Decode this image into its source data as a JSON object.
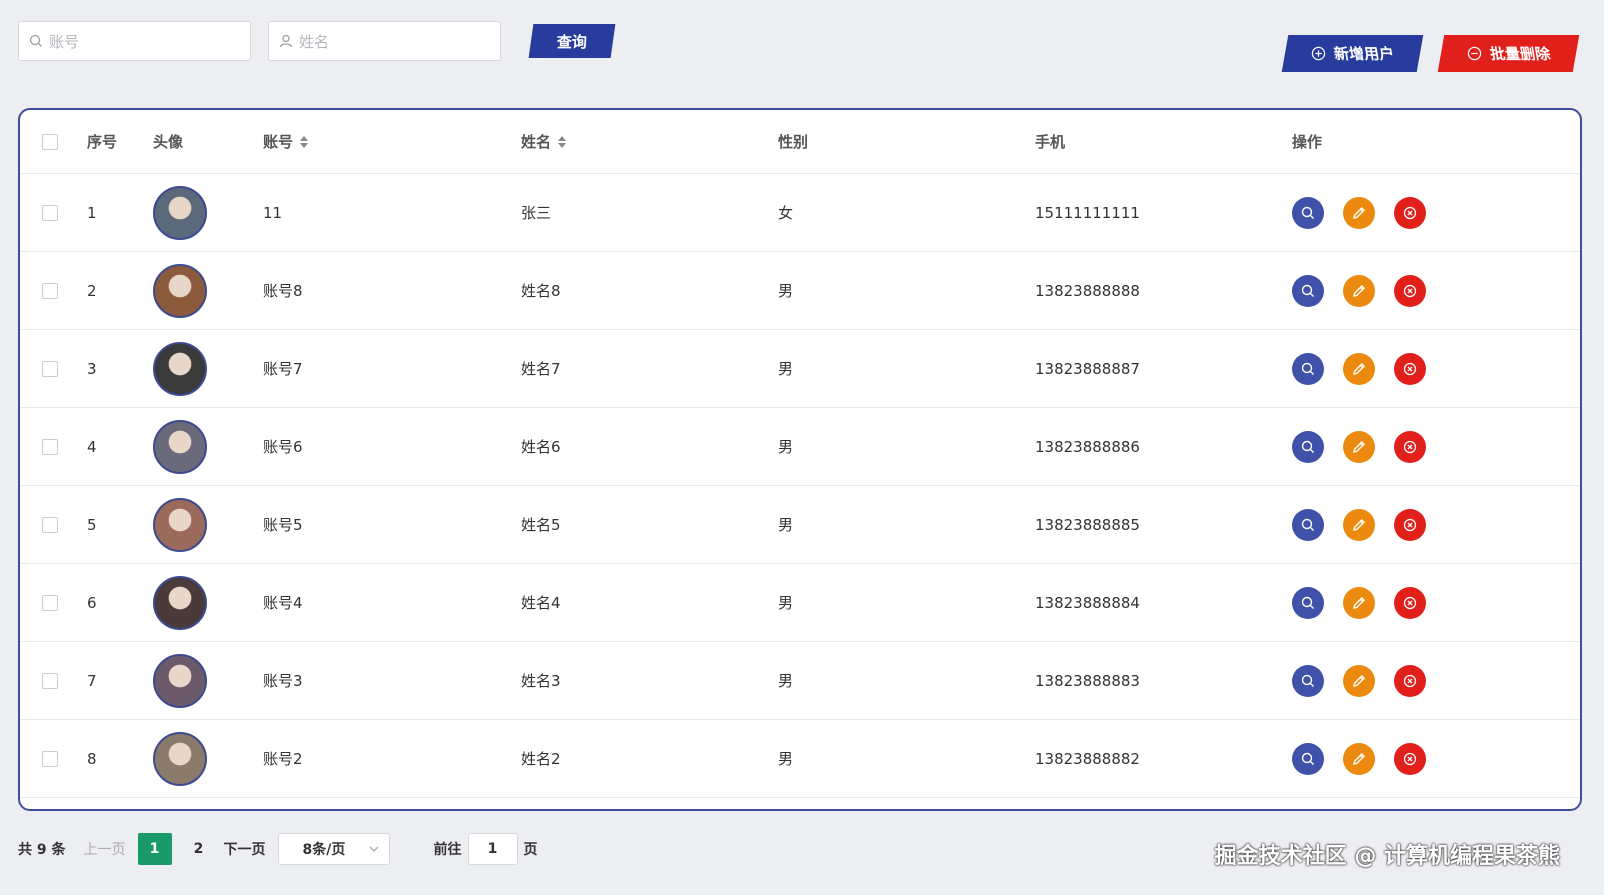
{
  "search": {
    "account_placeholder": "账号",
    "name_placeholder": "姓名",
    "query_label": "查询"
  },
  "toolbar": {
    "add_label": "新增用户",
    "batch_delete_label": "批量删除"
  },
  "table": {
    "headers": {
      "index": "序号",
      "avatar": "头像",
      "account": "账号",
      "name": "姓名",
      "gender": "性别",
      "phone": "手机",
      "actions": "操作"
    },
    "rows": [
      {
        "index": "1",
        "account": "11",
        "name": "张三",
        "gender": "女",
        "phone": "15111111111"
      },
      {
        "index": "2",
        "account": "账号8",
        "name": "姓名8",
        "gender": "男",
        "phone": "13823888888"
      },
      {
        "index": "3",
        "account": "账号7",
        "name": "姓名7",
        "gender": "男",
        "phone": "13823888887"
      },
      {
        "index": "4",
        "account": "账号6",
        "name": "姓名6",
        "gender": "男",
        "phone": "13823888886"
      },
      {
        "index": "5",
        "account": "账号5",
        "name": "姓名5",
        "gender": "男",
        "phone": "13823888885"
      },
      {
        "index": "6",
        "account": "账号4",
        "name": "姓名4",
        "gender": "男",
        "phone": "13823888884"
      },
      {
        "index": "7",
        "account": "账号3",
        "name": "姓名3",
        "gender": "男",
        "phone": "13823888883"
      },
      {
        "index": "8",
        "account": "账号2",
        "name": "姓名2",
        "gender": "男",
        "phone": "13823888882"
      }
    ]
  },
  "pagination": {
    "total": "共 9 条",
    "prev": "上一页",
    "pages": [
      "1",
      "2"
    ],
    "current": "1",
    "next": "下一页",
    "page_size": "8条/页",
    "goto_label": "前往",
    "goto_value": "1",
    "goto_suffix": "页"
  },
  "watermark": "掘金技术社区 @ 计算机编程果茶熊",
  "colors": {
    "primary": "#283c9e",
    "danger": "#e1201c",
    "warning": "#eb8a0f",
    "success": "#1a9a6b"
  }
}
